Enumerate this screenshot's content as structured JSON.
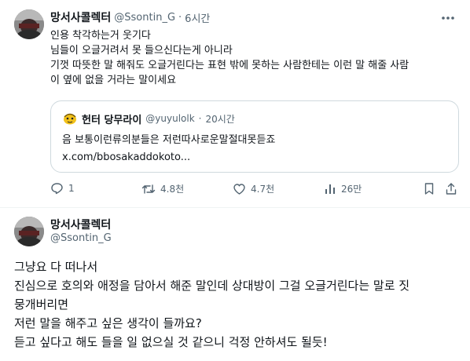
{
  "tweet": {
    "display_name": "망서사콜렉터",
    "handle": "@Ssontin_G",
    "time_sep": "·",
    "time": "6시간",
    "lines": [
      "인용 착각하는거 웃기다",
      "님들이 오글거려서 못 들으신다는게 아니라",
      "기껏 따뜻한 말 해줘도 오글거린다는 표현 밖에 못하는 사람한테는 이런 말 해줄 사람",
      "이 옆에 없을 거라는 말이세요"
    ],
    "quote": {
      "display_name": "헌터 당무라이",
      "handle": "@yuyulolk",
      "time_sep": "·",
      "time": "20시간",
      "text": "음  보통이런류의분들은 저런따사로운말절대못듣죠",
      "link": "x.com/bbosakaddokoto..."
    },
    "actions": {
      "replies": "1",
      "retweets": "4.8천",
      "likes": "4.7천",
      "views": "26만"
    }
  },
  "reply": {
    "display_name": "망서사콜렉터",
    "handle": "@Ssontin_G",
    "lines": [
      "그냥요 다 떠나서",
      "진심으로 호의와 애정을 담아서 해준 말인데 상대방이 그걸 오글거린다는 말로 짓",
      "뭉개버리면",
      "저런 말을 해주고 싶은 생각이 들까요?",
      "듣고 싶다고 해도 들을 일 없으실 것 같으니 걱정 안하셔도 될듯!"
    ]
  },
  "icons": {
    "more": "more-horizontal-icon",
    "reply": "reply-icon",
    "retweet": "retweet-icon",
    "like": "heart-icon",
    "views": "views-icon",
    "bookmark": "bookmark-icon",
    "share": "share-icon"
  },
  "colors": {
    "text": "#0f1419",
    "muted": "#536471",
    "border": "#cfd9de"
  }
}
